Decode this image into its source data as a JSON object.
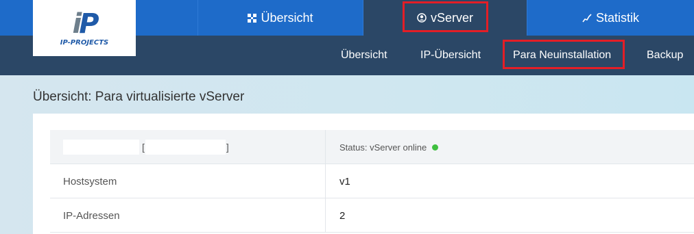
{
  "brand": {
    "logo_text": "IP-PROJECTS",
    "logo_mark_i": "i",
    "logo_mark_p": "P"
  },
  "top_nav": {
    "tabs": [
      {
        "label": "Übersicht",
        "icon": "grid-icon"
      },
      {
        "label": "vServer",
        "icon": "user-circle-icon",
        "active": true
      },
      {
        "label": "Statistik",
        "icon": "line-chart-icon"
      }
    ]
  },
  "sub_nav": {
    "items": [
      "Übersicht",
      "IP-Übersicht",
      "Para Neuinstallation",
      "Backup"
    ]
  },
  "page": {
    "title": "Übersicht: Para virtualisierte vServer"
  },
  "server_table": {
    "header_open_bracket": "[",
    "header_close_bracket": "]",
    "status_label": "Status: vServer online",
    "rows": [
      {
        "label": "Hostsystem",
        "value": "v1"
      },
      {
        "label": "IP-Adressen",
        "value": "2"
      }
    ]
  },
  "colors": {
    "top_nav": "#1e6bc9",
    "sub_nav": "#2b4766",
    "highlight": "#e41e26",
    "status_online": "#3fbf3f"
  }
}
